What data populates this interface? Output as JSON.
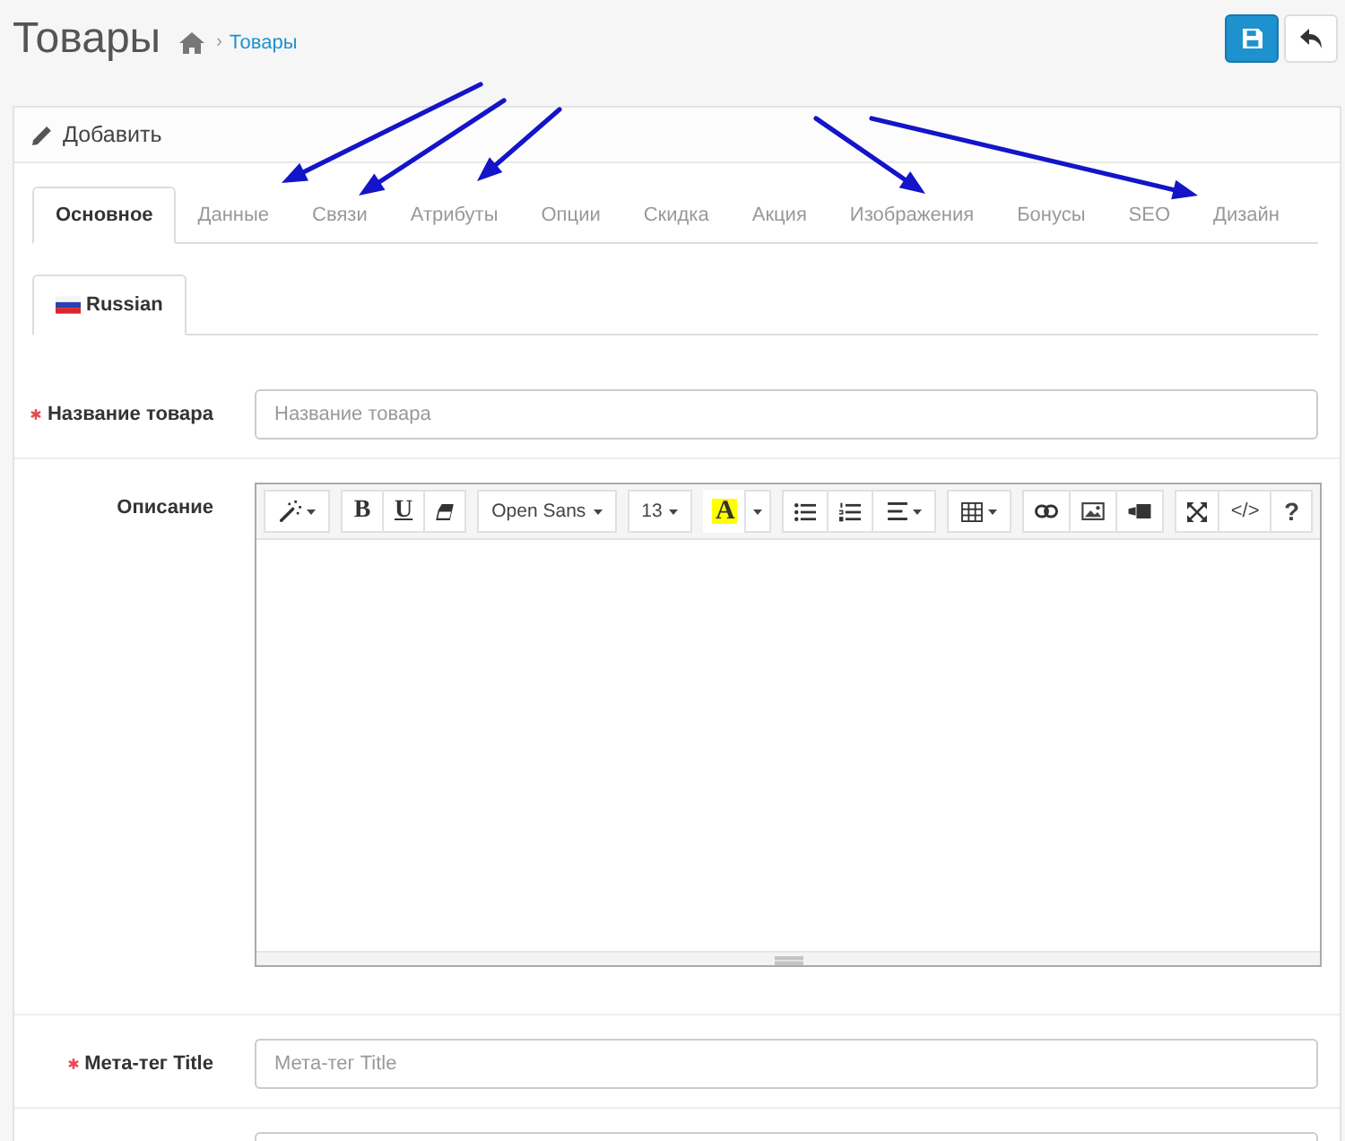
{
  "header": {
    "title": "Товары",
    "breadcrumb": [
      {
        "kind": "home"
      },
      {
        "kind": "link",
        "label": "Товары"
      }
    ],
    "breadcrumb_separator": "›",
    "buttons": [
      {
        "kind": "save"
      },
      {
        "kind": "back"
      }
    ]
  },
  "panel": {
    "title": "Добавить"
  },
  "tabs": [
    {
      "label": "Основное",
      "selected": true
    },
    {
      "label": "Данные",
      "selected": false
    },
    {
      "label": "Связи",
      "selected": false
    },
    {
      "label": "Атрибуты",
      "selected": false
    },
    {
      "label": "Опции",
      "selected": false
    },
    {
      "label": "Скидка",
      "selected": false
    },
    {
      "label": "Акция",
      "selected": false
    },
    {
      "label": "Изображения",
      "selected": false
    },
    {
      "label": "Бонусы",
      "selected": false
    },
    {
      "label": "SEO",
      "selected": false
    },
    {
      "label": "Дизайн",
      "selected": false
    }
  ],
  "annotations": [
    {
      "kind": "arrow"
    },
    {
      "kind": "arrow"
    },
    {
      "kind": "arrow"
    },
    {
      "kind": "arrow"
    },
    {
      "kind": "arrow"
    }
  ],
  "languages": [
    {
      "label": "Russian",
      "selected": true
    }
  ],
  "fields": [
    {
      "kind": "text",
      "label": "Название товара",
      "required": true,
      "placeholder": "Название товара"
    },
    {
      "kind": "editor",
      "label": "Описание",
      "required": false,
      "toolbar": [
        [
          {
            "kind": "wand"
          }
        ],
        [
          {
            "kind": "bold",
            "label": "B"
          },
          {
            "kind": "underline",
            "label": "U"
          },
          {
            "kind": "eraser"
          }
        ],
        [
          {
            "kind": "dropdown",
            "label": "Open Sans"
          }
        ],
        [
          {
            "kind": "dropdown",
            "label": "13"
          }
        ],
        [
          {
            "kind": "highlight",
            "label": "A"
          },
          {
            "kind": "caret"
          }
        ],
        [
          {
            "kind": "bullets"
          },
          {
            "kind": "numbers"
          },
          {
            "kind": "align"
          }
        ],
        [
          {
            "kind": "table"
          }
        ],
        [
          {
            "kind": "link"
          },
          {
            "kind": "image"
          },
          {
            "kind": "video"
          }
        ],
        [
          {
            "kind": "fullscreen"
          },
          {
            "kind": "code",
            "label": "</>"
          },
          {
            "kind": "help",
            "label": "?"
          }
        ]
      ]
    },
    {
      "kind": "text",
      "label": "Мета-тег Title",
      "required": true,
      "placeholder": "Мета-тег Title"
    },
    {
      "kind": "text"
    }
  ]
}
